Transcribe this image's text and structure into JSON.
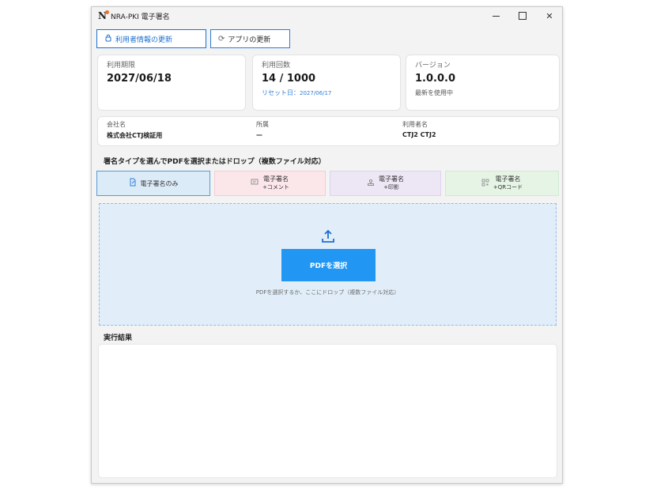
{
  "window": {
    "title": "NRA-PKI 電子署名",
    "logo_letter": "N",
    "controls": [
      "minimize",
      "maximize",
      "close"
    ]
  },
  "toolbar": {
    "update_user_info_label": "利用者情報の更新",
    "update_app_label": "アプリの更新"
  },
  "cards": {
    "expiry": {
      "label": "利用期限",
      "value": "2027/06/18"
    },
    "usage": {
      "label": "利用回数",
      "value": "14 / 1000",
      "reset_prefix": "リセット日：",
      "reset_date": "2027/06/17"
    },
    "version": {
      "label": "バージョン",
      "value": "1.0.0.0",
      "status": "最新を使用中"
    }
  },
  "info": {
    "company_label": "会社名",
    "company_value": "株式会社CTJ検証用",
    "dept_label": "所属",
    "dept_value": "—",
    "user_label": "利用者名",
    "user_value": "CTJ2 CTJ2"
  },
  "signature": {
    "section_title": "署名タイプを選んでPDFを選択またはドロップ（複数ファイル対応）",
    "types": [
      {
        "line1": "電子署名のみ",
        "line2": ""
      },
      {
        "line1": "電子署名",
        "line2": "+コメント"
      },
      {
        "line1": "電子署名",
        "line2": "+印影"
      },
      {
        "line1": "電子署名",
        "line2": "+QRコード"
      }
    ],
    "select_pdf_label": "PDFを選択",
    "drop_hint": "PDFを選択するか、ここにドロップ（複数ファイル対応）"
  },
  "result": {
    "title": "実行結果",
    "content": ""
  },
  "colors": {
    "accent": "#2196f3",
    "selected_bg": "#dcebf8",
    "drop_bg": "#e1eefa"
  }
}
